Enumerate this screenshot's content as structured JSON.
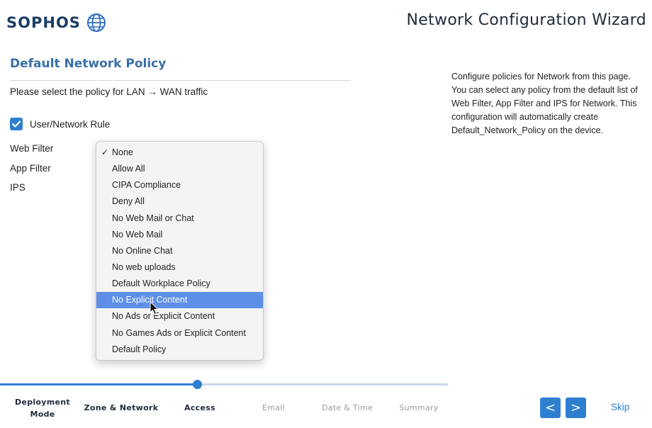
{
  "header": {
    "logo_text": "SOPHOS",
    "logo_icon": "globe-icon",
    "wizard_title": "Network Configuration Wizard"
  },
  "section": {
    "title": "Default Network Policy",
    "subtitle": "Please select the policy for LAN → WAN traffic"
  },
  "rule": {
    "label": "User/Network Rule",
    "checked": true
  },
  "form": {
    "labels": [
      "Web Filter",
      "App Filter",
      "IPS"
    ]
  },
  "dropdown": {
    "selected": "None",
    "highlighted": "No Explicit Content",
    "options": [
      "None",
      "Allow All",
      "CIPA Compliance",
      "Deny All",
      "No Web Mail or Chat",
      "No Web Mail",
      "No Online Chat",
      "No web uploads",
      "Default Workplace Policy",
      "No Explicit Content",
      "No Ads or Explicit Content",
      "No Games Ads or Explicit Content",
      "Default Policy"
    ]
  },
  "help": {
    "text": "Configure policies for Network from this page. You can select any policy from the default list of Web Filter, App Filter and IPS for Network. This configuration will automatically create Default_Network_Policy on the device."
  },
  "steps": [
    {
      "line1": "Deployment",
      "line2": "Mode"
    },
    {
      "line1": "Zone & Network",
      "line2": ""
    },
    {
      "line1": "Access",
      "line2": ""
    },
    {
      "line1": "Email",
      "line2": ""
    },
    {
      "line1": "Date & Time",
      "line2": ""
    },
    {
      "line1": "Summary",
      "line2": ""
    }
  ],
  "nav": {
    "prev_label": "<",
    "next_label": ">",
    "skip_label": "Skip"
  },
  "colors": {
    "accent": "#2f7fd1",
    "title_blue": "#3a6fa8",
    "logo_navy": "#1d3d66",
    "highlight": "#5d8fe6"
  }
}
